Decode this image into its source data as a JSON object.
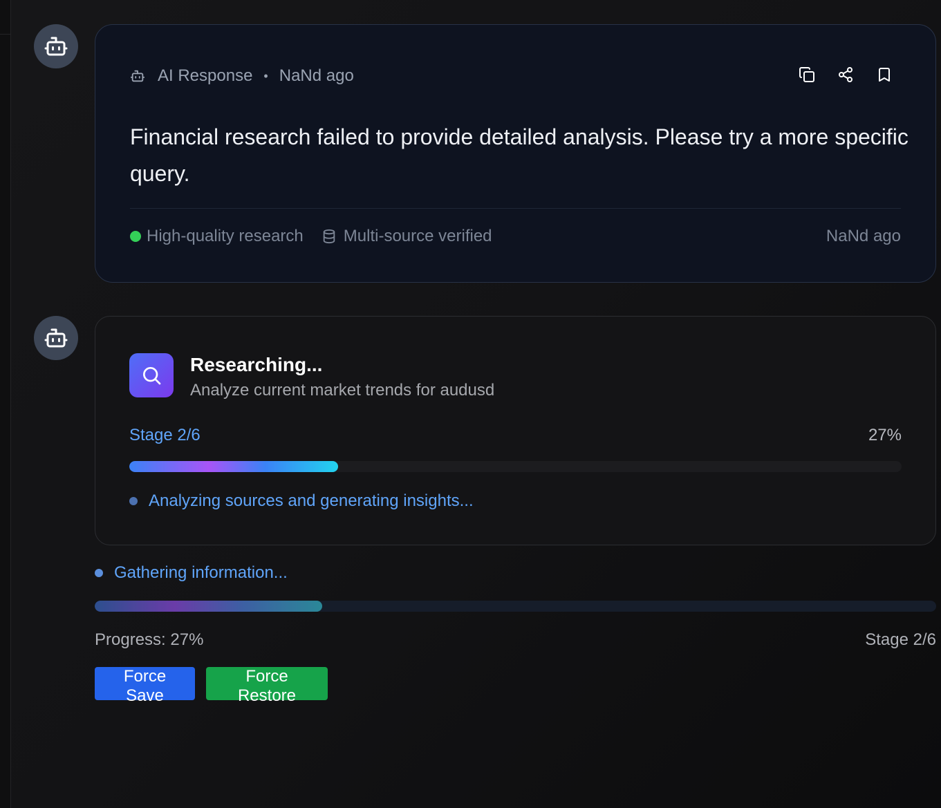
{
  "ai_card": {
    "label": "AI Response",
    "separator": "•",
    "time": "NaNd ago",
    "message": "Financial research failed to provide detailed analysis. Please try a more specific query.",
    "quality_label": "High-quality research",
    "sources_label": "Multi-source verified",
    "footer_time": "NaNd ago",
    "actions": [
      "copy-icon",
      "share-icon",
      "bookmark-icon"
    ]
  },
  "research_card": {
    "title": "Researching...",
    "subtitle": "Analyze current market trends for audusd",
    "stage_label": "Stage 2/6",
    "percent_label": "27%",
    "progress": 0.27,
    "status": "Analyzing sources and generating insights..."
  },
  "progress_panel": {
    "status": "Gathering information...",
    "progress": 0.27,
    "progress_label": "Progress: 27%",
    "stage_label": "Stage 2/6"
  },
  "buttons": {
    "force_save": "Force Save",
    "force_restore": "Force Restore"
  },
  "colors": {
    "accent_blue": "#60a5fa",
    "save_button": "#2563eb",
    "restore_button": "#16a34a",
    "quality_dot": "#34d058"
  }
}
